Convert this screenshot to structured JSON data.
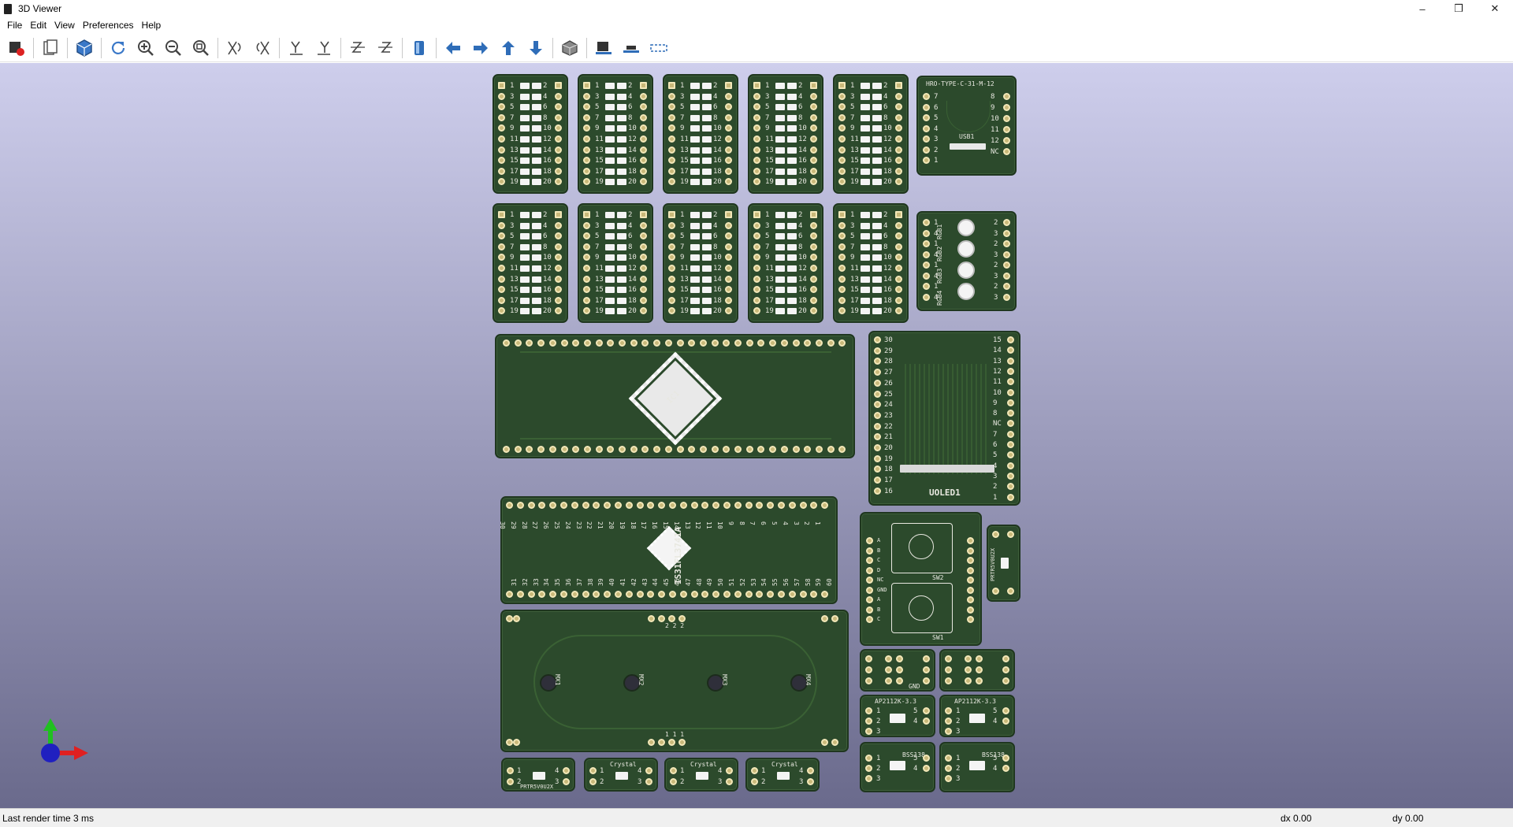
{
  "window": {
    "title": "3D Viewer",
    "controls": [
      "–",
      "❒",
      "✕"
    ]
  },
  "menu": [
    "File",
    "Edit",
    "View",
    "Preferences",
    "Help"
  ],
  "toolbar": {
    "tools": [
      "render-options-icon",
      "copy-image-icon",
      "3d-view-icon",
      "reload-icon",
      "zoom-in-icon",
      "zoom-out-icon",
      "zoom-fit-icon",
      "rotate-x-cw-icon",
      "rotate-x-ccw-icon",
      "rotate-y-cw-icon",
      "rotate-y-ccw-icon",
      "rotate-z-cw-icon",
      "rotate-z-ccw-icon",
      "flip-board-icon",
      "pan-left-icon",
      "pan-right-icon",
      "pan-up-icon",
      "pan-down-icon",
      "ortho-icon",
      "show-footprints-icon",
      "show-board-body-icon",
      "show-outline-icon"
    ]
  },
  "colors": {
    "board": "#2c4a2c",
    "silk": "#e8e8e0",
    "pad": "#c9b97a",
    "bg_top": "#ceceec",
    "bg_bottom": "#6a6a8c",
    "axis_x": "#e02020",
    "axis_y": "#20c020",
    "axis_z": "#2020c0"
  },
  "boards": {
    "header_rows": [
      [
        "1",
        "2"
      ],
      [
        "3",
        "4"
      ],
      [
        "5",
        "6"
      ],
      [
        "7",
        "8"
      ],
      [
        "9",
        "10"
      ],
      [
        "11",
        "12"
      ],
      [
        "13",
        "14"
      ],
      [
        "15",
        "16"
      ],
      [
        "17",
        "18"
      ],
      [
        "19",
        "20"
      ]
    ],
    "usb": {
      "ref": "USB1",
      "part": "HRO-TYPE-C-31-M-12",
      "left": [
        "7",
        "6",
        "5",
        "4",
        "3",
        "2",
        "1"
      ],
      "right": [
        "8",
        "9",
        "10",
        "11",
        "12",
        "NC"
      ]
    },
    "rgb": {
      "labels": [
        "RGB1",
        "RGB2",
        "RGB3",
        "RGB4"
      ],
      "left": [
        "1",
        "4",
        "1",
        "4",
        "1",
        "4",
        "1",
        "4"
      ],
      "right": [
        "2",
        "3",
        "2",
        "3",
        "2",
        "3",
        "2",
        "3"
      ]
    },
    "ic": {
      "ref": "IC1",
      "part": "IS31FL3741A",
      "top_nums": [
        "30",
        "29",
        "28",
        "27",
        "26",
        "25",
        "24",
        "23",
        "22",
        "21",
        "20",
        "19",
        "18",
        "17",
        "16",
        "15",
        "14",
        "13",
        "12",
        "11",
        "10",
        "9",
        "8",
        "7",
        "6",
        "5",
        "4",
        "3",
        "2",
        "1"
      ],
      "bottom_nums": [
        "31",
        "32",
        "33",
        "34",
        "35",
        "36",
        "37",
        "38",
        "39",
        "40",
        "41",
        "42",
        "43",
        "44",
        "45",
        "46",
        "47",
        "48",
        "49",
        "50",
        "51",
        "52",
        "53",
        "54",
        "55",
        "56",
        "57",
        "58",
        "59",
        "60"
      ]
    },
    "oled": {
      "ref": "UOLED1",
      "left": [
        "30",
        "29",
        "28",
        "27",
        "26",
        "25",
        "24",
        "23",
        "22",
        "21",
        "20",
        "19",
        "18",
        "17",
        "16"
      ],
      "right": [
        "15",
        "14",
        "13",
        "12",
        "11",
        "10",
        "9",
        "8",
        "NC",
        "7",
        "6",
        "5",
        "4",
        "3",
        "2",
        "1"
      ]
    },
    "switches": {
      "sw1": "SW1",
      "sw2": "SW2",
      "labels": [
        "A",
        "B",
        "C",
        "D",
        "NC",
        "GND",
        "A",
        "B",
        "C"
      ]
    },
    "mx": {
      "labels": [
        "MX1",
        "MX2",
        "MX3",
        "MX4"
      ],
      "top": "2 2 2",
      "bottom": "1 1 1"
    },
    "small": {
      "prtr": "PRTR5V0U2X",
      "crystal": "Crystal",
      "ap": "AP2112K-3.3",
      "bss": "BSS138",
      "gnd": "GND",
      "pins123": [
        "1",
        "2",
        "3"
      ],
      "pins45": [
        "5",
        "4"
      ],
      "pins1234": [
        "1",
        "2",
        "4",
        "3"
      ],
      "pins_hdr": [
        "1",
        "2",
        "3",
        "4",
        "5",
        "6"
      ]
    }
  },
  "status": {
    "message": "Last render time 3 ms",
    "dx": "dx 0.00",
    "dy": "dy 0.00"
  }
}
